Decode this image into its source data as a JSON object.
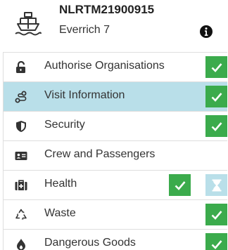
{
  "header": {
    "voyage_id": "NLRTM21900915",
    "vessel_name": "Everrich 7",
    "ship_icon": "ship-icon",
    "info_icon": "info-icon"
  },
  "menu": {
    "items": [
      {
        "label": "Authorise Organisations",
        "icon": "unlock-icon",
        "status": [
          "done"
        ]
      },
      {
        "label": "Visit Information",
        "icon": "route-icon",
        "status": [
          "done"
        ],
        "active": true
      },
      {
        "label": "Security",
        "icon": "shield-icon",
        "status": [
          "done"
        ]
      },
      {
        "label": "Crew and Passengers",
        "icon": "id-card-icon",
        "status": []
      },
      {
        "label": "Health",
        "icon": "medical-kit-icon",
        "status": [
          "done",
          "pending"
        ]
      },
      {
        "label": "Waste",
        "icon": "recycle-icon",
        "status": [
          "done"
        ]
      },
      {
        "label": "Dangerous Goods",
        "icon": "fire-icon",
        "status": [
          "done"
        ]
      }
    ]
  },
  "colors": {
    "done": "#3bab4c",
    "active_row": "#b9dfe9",
    "pending": "#b9dfe9"
  }
}
